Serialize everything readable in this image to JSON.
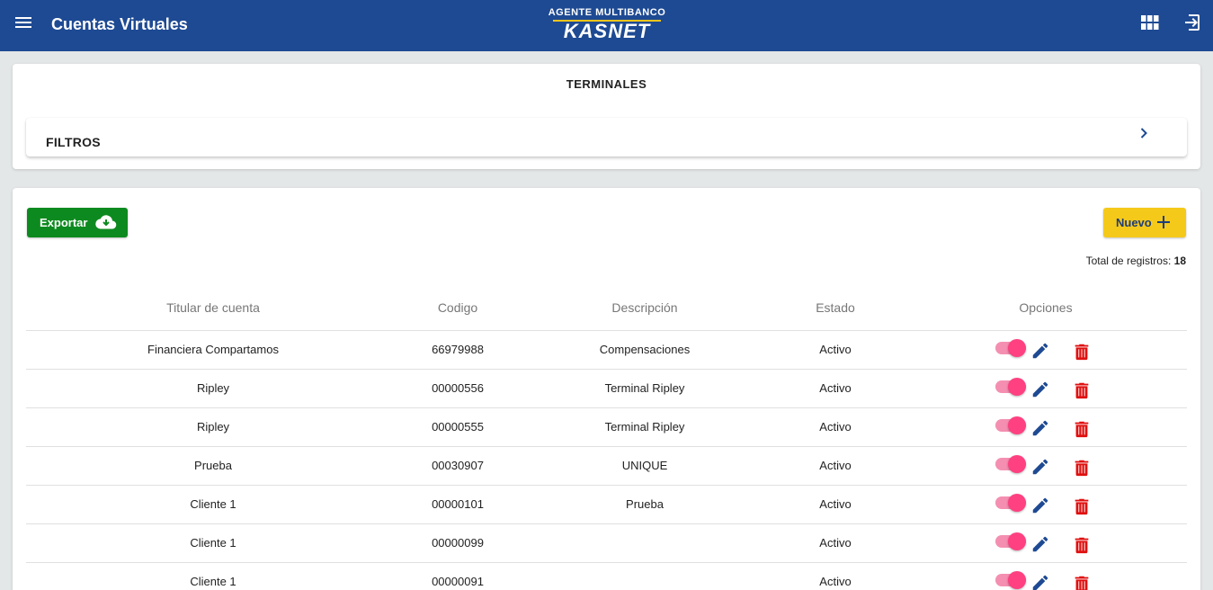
{
  "header": {
    "title": "Cuentas Virtuales",
    "logo_top": "AGENTE MULTIBANCO",
    "logo_main": "KASNET",
    "icons": [
      "menu-icon",
      "grid-icon",
      "exit-icon"
    ]
  },
  "section": {
    "title": "TERMINALES",
    "filters_label": "FILTROS"
  },
  "actions": {
    "export_label": "Exportar",
    "new_label": "Nuevo",
    "total_label": "Total de registros:",
    "total_value": "18"
  },
  "table": {
    "headers": [
      "Titular de cuenta",
      "Codigo",
      "Descripción",
      "Estado",
      "Opciones"
    ],
    "rows": [
      {
        "titular": "Financiera Compartamos",
        "codigo": "66979988",
        "descripcion": "Compensaciones",
        "estado": "Activo",
        "enabled": true
      },
      {
        "titular": "Ripley",
        "codigo": "00000556",
        "descripcion": "Terminal Ripley",
        "estado": "Activo",
        "enabled": true
      },
      {
        "titular": "Ripley",
        "codigo": "00000555",
        "descripcion": "Terminal Ripley",
        "estado": "Activo",
        "enabled": true
      },
      {
        "titular": "Prueba",
        "codigo": "00030907",
        "descripcion": "UNIQUE",
        "estado": "Activo",
        "enabled": true
      },
      {
        "titular": "Cliente 1",
        "codigo": "00000101",
        "descripcion": "Prueba",
        "estado": "Activo",
        "enabled": true
      },
      {
        "titular": "Cliente 1",
        "codigo": "00000099",
        "descripcion": "",
        "estado": "Activo",
        "enabled": true
      },
      {
        "titular": "Cliente 1",
        "codigo": "00000091",
        "descripcion": "",
        "estado": "Activo",
        "enabled": true
      }
    ]
  },
  "colors": {
    "header_bg": "#1e4a93",
    "export_bg": "#0d8a1f",
    "new_bg": "#f5c91a",
    "toggle_on": "#ff4081",
    "edit_icon": "#1e4a93",
    "delete_icon": "#e01010"
  }
}
